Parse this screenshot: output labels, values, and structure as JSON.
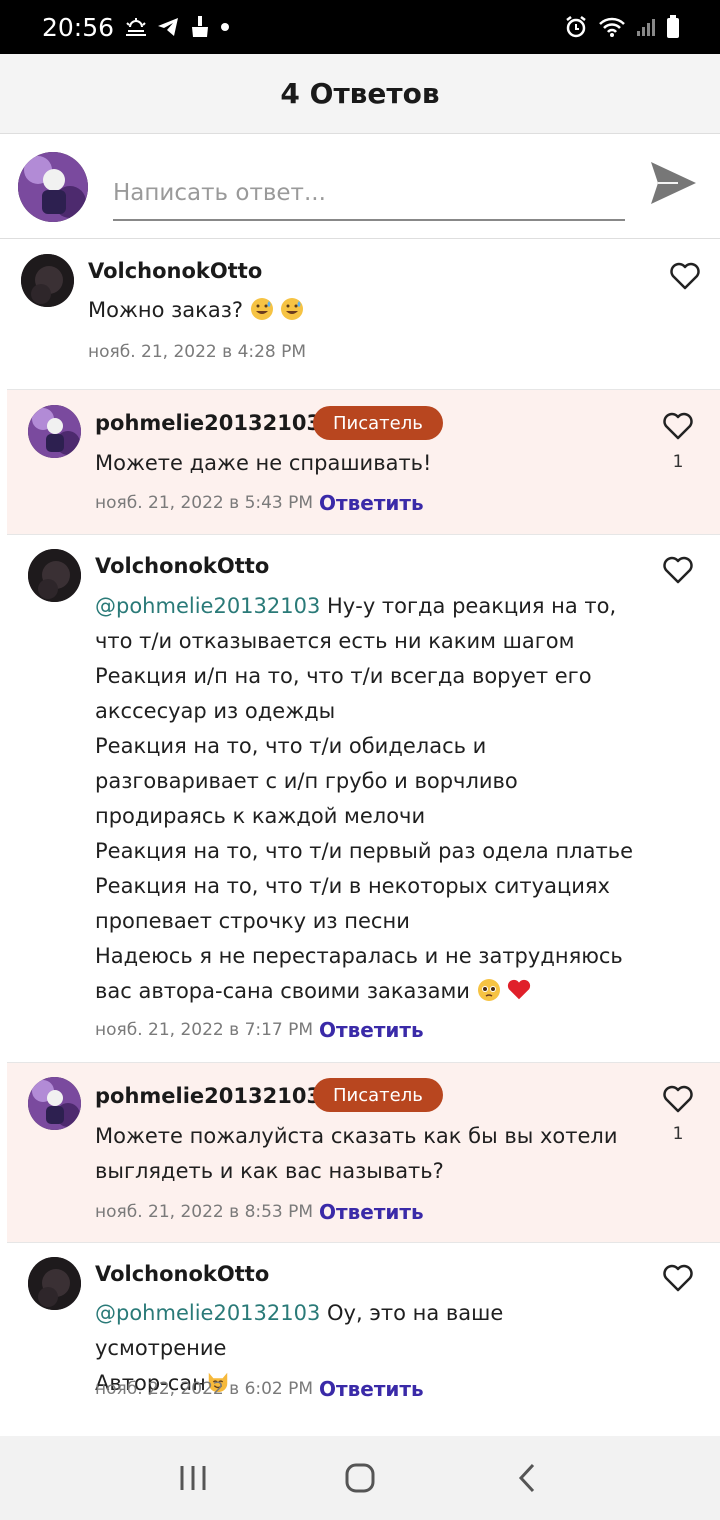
{
  "status": {
    "time": "20:56"
  },
  "header": {
    "title": "4 Ответов"
  },
  "composer": {
    "placeholder": "Написать ответ..."
  },
  "comments": [
    {
      "user": "VolchonokOtto",
      "text": "Можно заказ?",
      "date": "нояб. 21, 2022 в 4:28 PM",
      "reply_label": "",
      "likes": ""
    },
    {
      "user": "pohmelie20132103",
      "badge": "Писатель",
      "text": "Можете даже не спрашивать!",
      "date": "нояб. 21, 2022 в 5:43 PM",
      "reply_label": "Ответить",
      "likes": "1"
    },
    {
      "user": "VolchonokOtto",
      "mention": "@pohmelie20132103",
      "lines": [
        " Ну-у тогда реакция на то,",
        "что т/и отказывается есть ни каким шагом",
        "Реакция и/п на то, что т/и всегда ворует его",
        "акссесуар из одежды",
        "Реакция на то, что т/и обиделась и",
        "разговаривает с и/п грубо и ворчливо",
        "продираясь к каждой мелочи",
        "Реакция на то, что т/и первый раз одела платье",
        "Реакция на то, что т/и в некоторых ситуациях",
        "пропевает строчку из песни",
        "Надеюсь я не перестаралась и не затрудняюсь",
        "вас автора-сана своими заказами"
      ],
      "date": "нояб. 21, 2022 в 7:17 PM",
      "reply_label": "Ответить",
      "likes": ""
    },
    {
      "user": "pohmelie20132103",
      "badge": "Писатель",
      "lines": [
        "Можете пожалуйста сказать как бы вы хотели",
        "выглядеть и как вас называть?"
      ],
      "date": "нояб. 21, 2022 в 8:53 PM",
      "reply_label": "Ответить",
      "likes": "1"
    },
    {
      "user": "VolchonokOtto",
      "mention": "@pohmelie20132103",
      "lines": [
        " Оу, это на ваше усмотрение",
        "Автор-сан"
      ],
      "date": "нояб. 22, 2022 в 6:02 PM",
      "reply_label": "Ответить",
      "likes": ""
    }
  ]
}
